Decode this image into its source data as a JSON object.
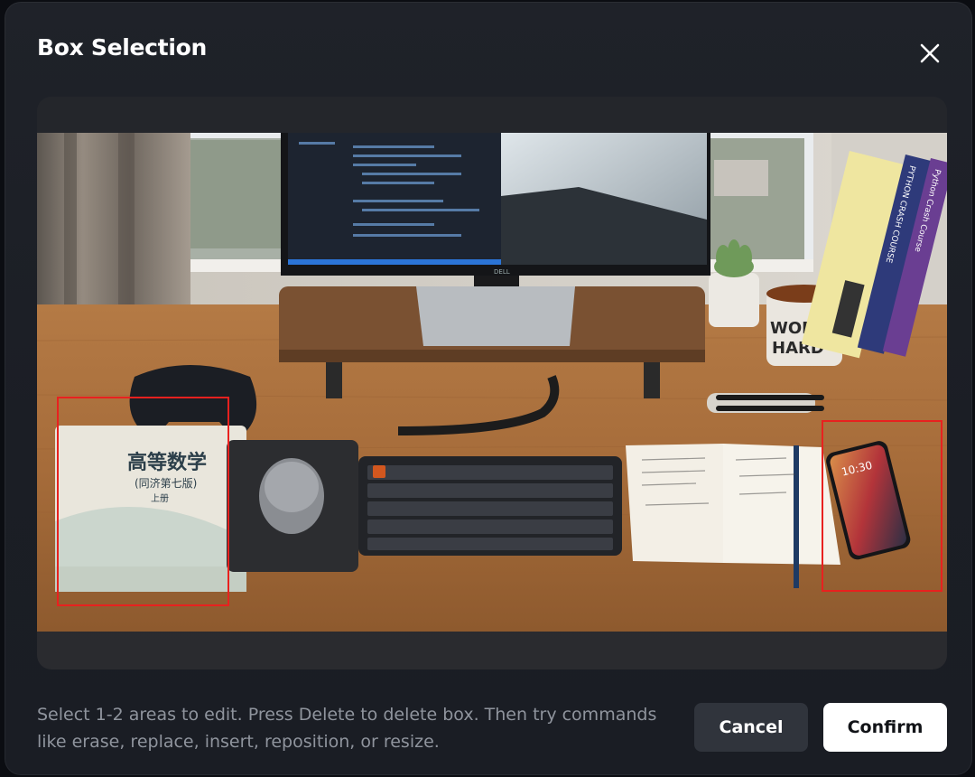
{
  "dialog": {
    "title": "Box Selection",
    "close_icon": "close-icon",
    "help_text": "Select 1-2 areas to edit. Press Delete to delete box. Then try commands like erase, replace, insert, reposition, or resize.",
    "cancel_label": "Cancel",
    "confirm_label": "Confirm"
  },
  "photo": {
    "book_title": "高等数学",
    "book_subtitle": "(同济第七版)",
    "book_volume": "上册",
    "mug_text_1": "WORK",
    "mug_text_2": "HARD",
    "spine_1": "PYTHON CRASH COURSE",
    "spine_2": "Python Crash Course",
    "monitor_logo": "DELL",
    "phone_time": "10:30"
  },
  "selection": {
    "count": 2,
    "box_color": "#e8211f"
  }
}
